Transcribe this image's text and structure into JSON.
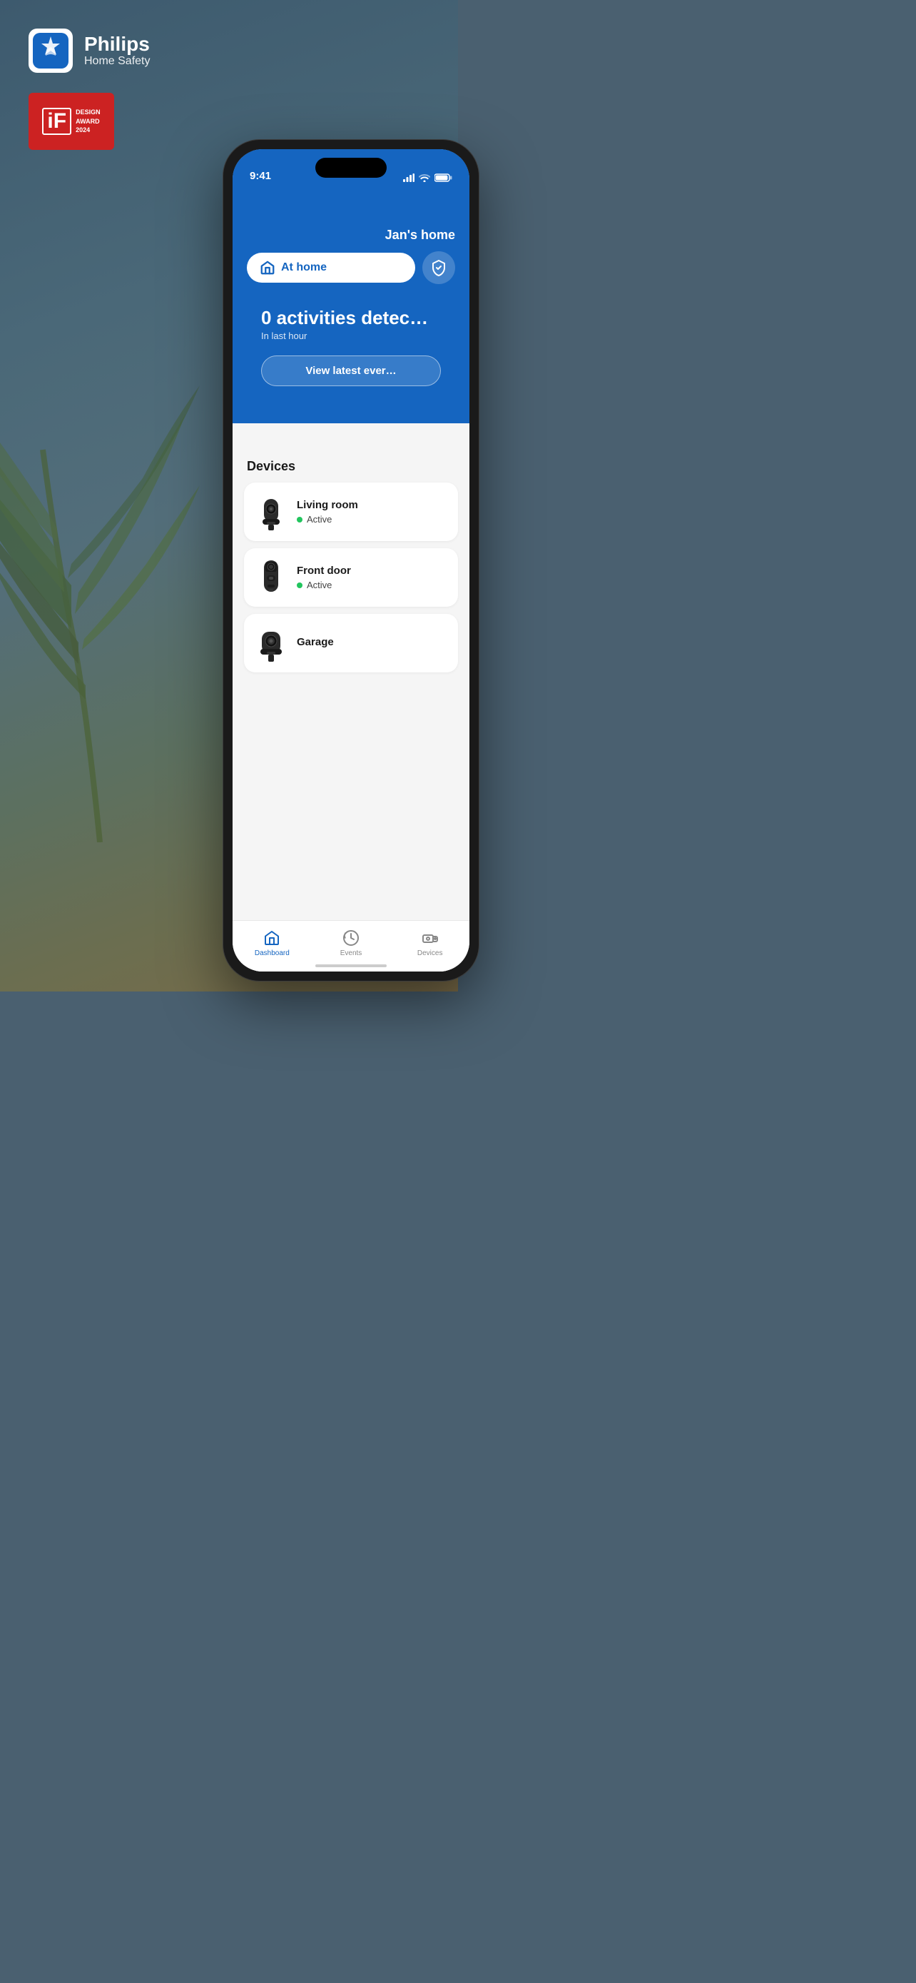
{
  "background": {
    "color_top": "#3d5a6e",
    "color_bottom": "#7a6b48"
  },
  "header": {
    "brand_name": "Philips",
    "brand_subtitle": "Home Safety",
    "award": {
      "label_if": "iF",
      "label_design": "DESIGN",
      "label_award": "AWARD",
      "label_year": "2024"
    }
  },
  "phone": {
    "status_bar": {
      "time": "9:41",
      "icons": [
        "signal",
        "wifi",
        "battery"
      ]
    },
    "app": {
      "home_name": "Jan's home",
      "mode": {
        "label": "At home",
        "icon": "house-icon"
      },
      "activities": {
        "count": "0 activities detec…",
        "subtitle": "In last hour"
      },
      "view_button": "View latest ever…",
      "devices_section": {
        "title": "Devices",
        "items": [
          {
            "name": "Living room",
            "status": "Active",
            "type": "indoor-camera"
          },
          {
            "name": "Front door",
            "status": "Active",
            "type": "doorbell-camera"
          },
          {
            "name": "Garage",
            "status": "",
            "type": "outdoor-camera"
          }
        ]
      },
      "nav": {
        "items": [
          {
            "label": "Dashboard",
            "icon": "house-nav-icon",
            "active": true
          },
          {
            "label": "Events",
            "icon": "history-icon",
            "active": false
          },
          {
            "label": "Devices",
            "icon": "camera-nav-icon",
            "active": false
          }
        ]
      }
    }
  }
}
